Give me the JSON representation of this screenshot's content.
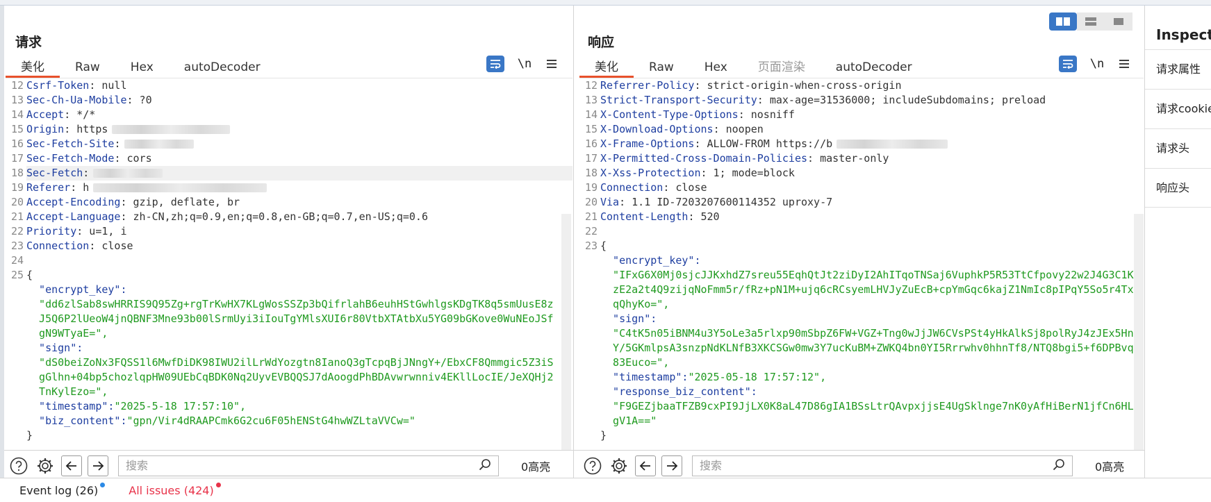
{
  "request": {
    "title": "请求",
    "tabs": [
      {
        "label": "美化",
        "active": true
      },
      {
        "label": "Raw"
      },
      {
        "label": "Hex"
      },
      {
        "label": "autoDecoder"
      }
    ],
    "newline_label": "\\n",
    "lines": [
      {
        "n": "12",
        "k": "Csrf-Token",
        "v": " null"
      },
      {
        "n": "13",
        "k": "Sec-Ch-Ua-Mobile",
        "v": " ?0"
      },
      {
        "n": "14",
        "k": "Accept",
        "v": " */*"
      },
      {
        "n": "15",
        "k": "Origin",
        "v": " https"
      },
      {
        "n": "16",
        "k": "Sec-Fetch-Site",
        "v": ""
      },
      {
        "n": "17",
        "k": "Sec-Fetch-Mode",
        "v": " cors"
      },
      {
        "n": "18",
        "k": "Sec-Fetch",
        "v": ""
      },
      {
        "n": "19",
        "k": "Referer",
        "v": " h"
      },
      {
        "n": "20",
        "k": "Accept-Encoding",
        "v": " gzip, deflate, br"
      },
      {
        "n": "21",
        "k": "Accept-Language",
        "v": " zh-CN,zh;q=0.9,en;q=0.8,en-GB;q=0.7,en-US;q=0.6"
      },
      {
        "n": "22",
        "k": "Priority",
        "v": " u=1, i"
      },
      {
        "n": "23",
        "k": "Connection",
        "v": " close"
      },
      {
        "n": "24",
        "t": ""
      },
      {
        "n": "25",
        "t": "{"
      },
      {
        "t": "  \"encrypt_key\":",
        "json_key": true
      },
      {
        "t": "  \"dd6zlSab8swHRRIS9Q95Zg+rgTrKwHX7KLgWosSSZp3bQifrlahB6euhHStGwhlgsKDgTK8q5smUusE8z",
        "json_val": true
      },
      {
        "t": "  J5Q6P2lUeoW4jnQBNF3Mne93b00lSrmUyi3iIouTgYMlsXUI6r80VtbXTAtbXu5YG09bGKove0WuNEoJSf",
        "json_val": true
      },
      {
        "t": "  gN9WTyaE=\",",
        "json_val": true
      },
      {
        "t": "  \"sign\":",
        "json_key": true
      },
      {
        "t": "  \"dS0beiZoNx3FQSS1l6MwfDiDK98IWU2ilLrWdYozgtn8IanoQ3gTcpqBjJNngY+/EbxCF8Qmmgic5Z3iS",
        "json_val": true
      },
      {
        "t": "  gGlhn+04bp5chozlqpHW09UEbCqBDK0Nq2UyvEVBQQSJ7dAoogdPhBDAvwrwnniv4EKllLocIE/JeXQHj2",
        "json_val": true
      },
      {
        "t": "  TnKylEzo=\",",
        "json_val": true
      },
      {
        "t": "  \"timestamp\":",
        "json_key": true,
        "v": "\"2025-5-18 17:57:10\","
      },
      {
        "t": "  \"biz_content\":",
        "json_key": true,
        "v": "\"gpn/Vir4dRAAPCmk6G2cu6F05hENStG4hwWZLtaVVCw=\""
      },
      {
        "t": "}"
      }
    ],
    "search_placeholder": "搜索",
    "hits": "0高亮"
  },
  "response": {
    "title": "响应",
    "tabs": [
      {
        "label": "美化",
        "active": true
      },
      {
        "label": "Raw"
      },
      {
        "label": "Hex"
      },
      {
        "label": "页面渲染",
        "disabled": true
      },
      {
        "label": "autoDecoder"
      }
    ],
    "newline_label": "\\n",
    "lines": [
      {
        "n": "12",
        "k": "Referrer-Policy",
        "v": " strict-origin-when-cross-origin"
      },
      {
        "n": "13",
        "k": "Strict-Transport-Security",
        "v": " max-age=31536000; includeSubdomains; preload"
      },
      {
        "n": "14",
        "k": "X-Content-Type-Options",
        "v": " nosniff"
      },
      {
        "n": "15",
        "k": "X-Download-Options",
        "v": " noopen"
      },
      {
        "n": "16",
        "k": "X-Frame-Options",
        "v": " ALLOW-FROM https://b"
      },
      {
        "n": "17",
        "k": "X-Permitted-Cross-Domain-Policies",
        "v": " master-only"
      },
      {
        "n": "18",
        "k": "X-Xss-Protection",
        "v": " 1; mode=block"
      },
      {
        "n": "19",
        "k": "Connection",
        "v": " close"
      },
      {
        "n": "20",
        "k": "Via",
        "v": " 1.1 ID-7203207600114352 uproxy-7"
      },
      {
        "n": "21",
        "k": "Content-Length",
        "v": " 520"
      },
      {
        "n": "22",
        "t": ""
      },
      {
        "n": "23",
        "t": "{"
      },
      {
        "t": "  \"encrypt_key\":",
        "json_key": true
      },
      {
        "t": "  \"IFxG6X0Mj0sjcJJKxhdZ7sreu55EqhQtJt2ziDyI2AhITqoTNSaj6VuphkP5R53TtCfpovy22w2J4G3C1K",
        "json_val": true
      },
      {
        "t": "  zE2a2t4Q9zijqNoFmm5r/fRz+pN1M+ujq6cRCsyemLHVJyZuEcB+cpYmGqc6kajZ1NmIc8pIPqY5So5r4Tx",
        "json_val": true
      },
      {
        "t": "  qQhyKo=\",",
        "json_val": true
      },
      {
        "t": "  \"sign\":",
        "json_key": true
      },
      {
        "t": "  \"C4tK5n05iBNM4u3Y5oLe3a5rlxp90mSbpZ6FW+VGZ+Tng0wJjJW6CVsPSt4yHkAlkSj8polRyJ4zJEx5Hn",
        "json_val": true
      },
      {
        "t": "  Y/5GKmlpsA3snzpNdKLNfB3XKCSGw0mw3Y7ucKuBM+ZWKQ4bn0YI5Rrrwhv0hhnTf8/NTQ8bgi5+f6DPBvq",
        "json_val": true
      },
      {
        "t": "  83Euco=\",",
        "json_val": true
      },
      {
        "t": "  \"timestamp\":",
        "json_key": true,
        "v": "\"2025-05-18 17:57:12\","
      },
      {
        "t": "  \"response_biz_content\":",
        "json_key": true
      },
      {
        "t": "  \"F9GEZjbaaTFZB9cxPI9JjLX0K8aL47D86gIA1BSsLtrQAvpxjjsE4UgSklnge7nK0yAfHiBerN1jfCn6HL",
        "json_val": true
      },
      {
        "t": "  gV1A==\"",
        "json_val": true
      },
      {
        "t": "}"
      }
    ],
    "search_placeholder": "搜索",
    "hits": "0高亮"
  },
  "inspector": {
    "title": "Inspector",
    "items": [
      "请求属性",
      "请求cookie",
      "请求头",
      "响应头"
    ]
  },
  "footer": {
    "event_log": "Event log (26)",
    "all_issues": "All issues (424)",
    "event_dot_color": "#2b8ae6",
    "issues_dot_color": "#e8334a",
    "issues_color": "#e8334a"
  },
  "colors": {
    "accent": "#3a77c6",
    "tab_underline": "#e8512c",
    "header_key": "#1e3ea0",
    "json_value": "#1f9a1f"
  }
}
